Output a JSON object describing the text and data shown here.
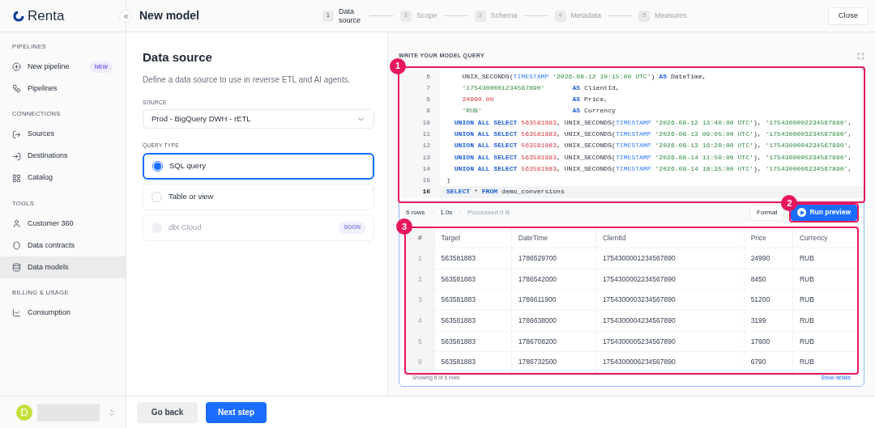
{
  "brand": {
    "name": "Renta"
  },
  "header": {
    "title": "New model",
    "close": "Close"
  },
  "steps": [
    {
      "number": "1",
      "label": "Data source",
      "selected": true
    },
    {
      "number": "2",
      "label": "Scope",
      "selected": false
    },
    {
      "number": "3",
      "label": "Schema",
      "selected": false
    },
    {
      "number": "4",
      "label": "Metadata",
      "selected": false
    },
    {
      "number": "5",
      "label": "Measures",
      "selected": false
    }
  ],
  "sidebar": {
    "sections": [
      {
        "title": "PIPELINES",
        "items": [
          {
            "label": "New pipeline",
            "badge": "NEW",
            "selected": false
          },
          {
            "label": "Pipelines",
            "selected": false
          }
        ]
      },
      {
        "title": "CONNECTIONS",
        "items": [
          {
            "label": "Sources",
            "selected": false
          },
          {
            "label": "Destinations",
            "selected": false
          },
          {
            "label": "Catalog",
            "selected": false
          }
        ]
      },
      {
        "title": "TOOLS",
        "items": [
          {
            "label": "Customer 360",
            "selected": false
          },
          {
            "label": "Data contracts",
            "selected": false
          },
          {
            "label": "Data models",
            "selected": true
          }
        ]
      },
      {
        "title": "BILLING & USAGE",
        "items": [
          {
            "label": "Consumption",
            "selected": false
          }
        ]
      }
    ],
    "user": {
      "initial": "D"
    }
  },
  "form": {
    "title": "Data source",
    "description": "Define a data source to use in reverse ETL and AI agents.",
    "source_label": "SOURCE",
    "source_value": "Prod - BigQuery DWH - rETL",
    "query_type_label": "QUERY TYPE",
    "query_types": [
      {
        "label": "SQL query",
        "selected": true,
        "disabled": false
      },
      {
        "label": "Table or view",
        "selected": false,
        "disabled": false
      },
      {
        "label": "dbt Cloud",
        "selected": false,
        "disabled": true,
        "badge": "SOON"
      }
    ]
  },
  "editor": {
    "label": "WRITE YOUR MODEL QUERY",
    "callout": "1",
    "lines": [
      {
        "number": "6",
        "active": false,
        "tokens": [
          {
            "kind": "plain",
            "text": "    UNIX_SECONDS("
          },
          {
            "kind": "type",
            "text": "TIMESTAMP"
          },
          {
            "kind": "str",
            "text": " '2026-08-12 10:15:00 UTC'"
          },
          {
            "kind": "plain",
            "text": ") "
          },
          {
            "kind": "kw",
            "text": "AS"
          },
          {
            "kind": "plain",
            "text": " DateTime,"
          }
        ]
      },
      {
        "number": "7",
        "active": false,
        "tokens": [
          {
            "kind": "str",
            "text": "    '1754300001234567890'"
          },
          {
            "kind": "kw",
            "text": "       AS"
          },
          {
            "kind": "plain",
            "text": " ClientId,"
          }
        ]
      },
      {
        "number": "8",
        "active": false,
        "tokens": [
          {
            "kind": "num",
            "text": "    24990.00"
          },
          {
            "kind": "kw",
            "text": "                    AS"
          },
          {
            "kind": "plain",
            "text": " Price,"
          }
        ]
      },
      {
        "number": "9",
        "active": false,
        "tokens": [
          {
            "kind": "str",
            "text": "    'RUB'"
          },
          {
            "kind": "kw",
            "text": "                       AS"
          },
          {
            "kind": "plain",
            "text": " Currency"
          }
        ]
      },
      {
        "number": "10",
        "active": false,
        "tokens": [
          {
            "kind": "kw",
            "text": "  UNION ALL SELECT"
          },
          {
            "kind": "num",
            "text": " 563581883"
          },
          {
            "kind": "plain",
            "text": ", UNIX_SECONDS("
          },
          {
            "kind": "type",
            "text": "TIMESTAMP"
          },
          {
            "kind": "str",
            "text": " '2026-08-12 13:40:00 UTC'"
          },
          {
            "kind": "plain",
            "text": "), "
          },
          {
            "kind": "str",
            "text": "'1754300002234567890'"
          },
          {
            "kind": "plain",
            "text": ","
          }
        ]
      },
      {
        "number": "11",
        "active": false,
        "tokens": [
          {
            "kind": "kw",
            "text": "  UNION ALL SELECT"
          },
          {
            "kind": "num",
            "text": " 563581883"
          },
          {
            "kind": "plain",
            "text": ", UNIX_SECONDS("
          },
          {
            "kind": "type",
            "text": "TIMESTAMP"
          },
          {
            "kind": "str",
            "text": " '2026-08-13 09:05:00 UTC'"
          },
          {
            "kind": "plain",
            "text": "), "
          },
          {
            "kind": "str",
            "text": "'1754300003234567890'"
          },
          {
            "kind": "plain",
            "text": ","
          }
        ]
      },
      {
        "number": "12",
        "active": false,
        "tokens": [
          {
            "kind": "kw",
            "text": "  UNION ALL SELECT"
          },
          {
            "kind": "num",
            "text": " 563581883"
          },
          {
            "kind": "plain",
            "text": ", UNIX_SECONDS("
          },
          {
            "kind": "type",
            "text": "TIMESTAMP"
          },
          {
            "kind": "str",
            "text": " '2026-08-13 16:20:00 UTC'"
          },
          {
            "kind": "plain",
            "text": "), "
          },
          {
            "kind": "str",
            "text": "'1754300004234567890'"
          },
          {
            "kind": "plain",
            "text": ","
          }
        ]
      },
      {
        "number": "13",
        "active": false,
        "tokens": [
          {
            "kind": "kw",
            "text": "  UNION ALL SELECT"
          },
          {
            "kind": "num",
            "text": " 563581883"
          },
          {
            "kind": "plain",
            "text": ", UNIX_SECONDS("
          },
          {
            "kind": "type",
            "text": "TIMESTAMP"
          },
          {
            "kind": "str",
            "text": " '2026-08-14 11:50:00 UTC'"
          },
          {
            "kind": "plain",
            "text": "), "
          },
          {
            "kind": "str",
            "text": "'1754300005234567890'"
          },
          {
            "kind": "plain",
            "text": ","
          }
        ]
      },
      {
        "number": "14",
        "active": false,
        "tokens": [
          {
            "kind": "kw",
            "text": "  UNION ALL SELECT"
          },
          {
            "kind": "num",
            "text": " 563581883"
          },
          {
            "kind": "plain",
            "text": ", UNIX_SECONDS("
          },
          {
            "kind": "type",
            "text": "TIMESTAMP"
          },
          {
            "kind": "str",
            "text": " '2026-08-14 18:35:00 UTC'"
          },
          {
            "kind": "plain",
            "text": "), "
          },
          {
            "kind": "str",
            "text": "'1754300006234567890'"
          },
          {
            "kind": "plain",
            "text": ","
          }
        ]
      },
      {
        "number": "15",
        "active": false,
        "tokens": [
          {
            "kind": "plain",
            "text": ")"
          }
        ]
      },
      {
        "number": "16",
        "active": true,
        "tokens": [
          {
            "kind": "kw",
            "text": "SELECT"
          },
          {
            "kind": "plain",
            "text": " * "
          },
          {
            "kind": "kw",
            "text": "FROM"
          },
          {
            "kind": "plain",
            "text": " demo_conversions"
          }
        ]
      }
    ]
  },
  "results": {
    "stats": [
      "6 rows",
      "1.0s",
      "Processed 0 B"
    ],
    "stat_separator": "·",
    "format": "Format",
    "run": "Run preview",
    "run_callout": "2",
    "table_callout": "3",
    "columns": [
      "#",
      "Target",
      "DateTime",
      "ClientId",
      "Price",
      "Currency"
    ],
    "rows": [
      [
        "1",
        "563581883",
        "1786529700",
        "1754300001234567890",
        "24990",
        "RUB"
      ],
      [
        "2",
        "563581883",
        "1786542000",
        "1754300002234567890",
        "8450",
        "RUB"
      ],
      [
        "3",
        "563581883",
        "1786611900",
        "1754300003234567890",
        "51200",
        "RUB"
      ],
      [
        "4",
        "563581883",
        "1786638000",
        "1754300004234567890",
        "3199",
        "RUB"
      ],
      [
        "5",
        "563581883",
        "1786708200",
        "1754300005234567890",
        "17600",
        "RUB"
      ],
      [
        "6",
        "563581883",
        "1786732500",
        "1754300006234567890",
        "6790",
        "RUB"
      ]
    ],
    "footer": "Showing 6 of 6 rows",
    "details": "Show details"
  },
  "actions": {
    "back": "Go back",
    "next": "Next step"
  }
}
